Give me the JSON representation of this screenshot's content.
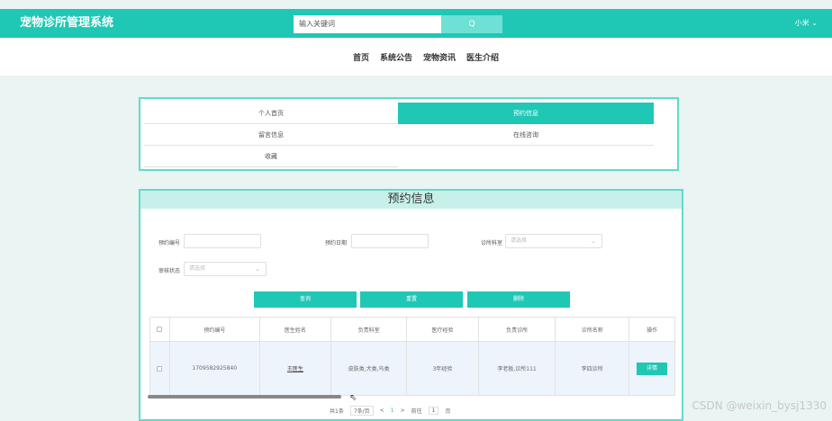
{
  "header": {
    "brand": "宠物诊所管理系统",
    "search_placeholder": "输入关键词",
    "search_button": "Q",
    "user": "小米 ⌄"
  },
  "nav": {
    "items": [
      "首页",
      "系统公告",
      "宠物资讯",
      "医生介绍"
    ]
  },
  "side_menu": {
    "items": [
      "个人首页",
      "预约信息",
      "留言信息",
      "在线咨询",
      "收藏"
    ],
    "active": "预约信息"
  },
  "main": {
    "title": "预约信息",
    "filters": {
      "appointment_no_label": "预约编号",
      "appointment_date_label": "预约日期",
      "clinic_dept_label": "诊所科室",
      "clinic_dept_placeholder": "请选择",
      "review_status_label": "审核状态",
      "review_status_placeholder": "请选择"
    },
    "actions": {
      "query": "查询",
      "reset": "重置",
      "delete": "删除"
    },
    "table": {
      "headers": [
        "预约编号",
        "医生姓名",
        "负责科室",
        "医疗经验",
        "负责诊所",
        "诊所名称",
        "操作"
      ],
      "rows": [
        {
          "no": "1709582925840",
          "doctor": "王医生",
          "dept": "皮肤类,犬类,鸟类",
          "experience": "3年经验",
          "clinic": "李老板,诊所111",
          "clinic_name": "李四诊所",
          "action": "详情"
        }
      ]
    },
    "pagination": {
      "total": "共1条",
      "page_size": "7条/页",
      "prev": "<",
      "current": "1",
      "next": ">",
      "goto_label": "前往",
      "goto_value": "1",
      "page_unit": "页"
    }
  },
  "watermark": "CSDN @weixin_bysj1330",
  "colors": {
    "accent": "#1fc7b5",
    "panel_border": "#5fdccc",
    "background": "#eaf4f2"
  }
}
